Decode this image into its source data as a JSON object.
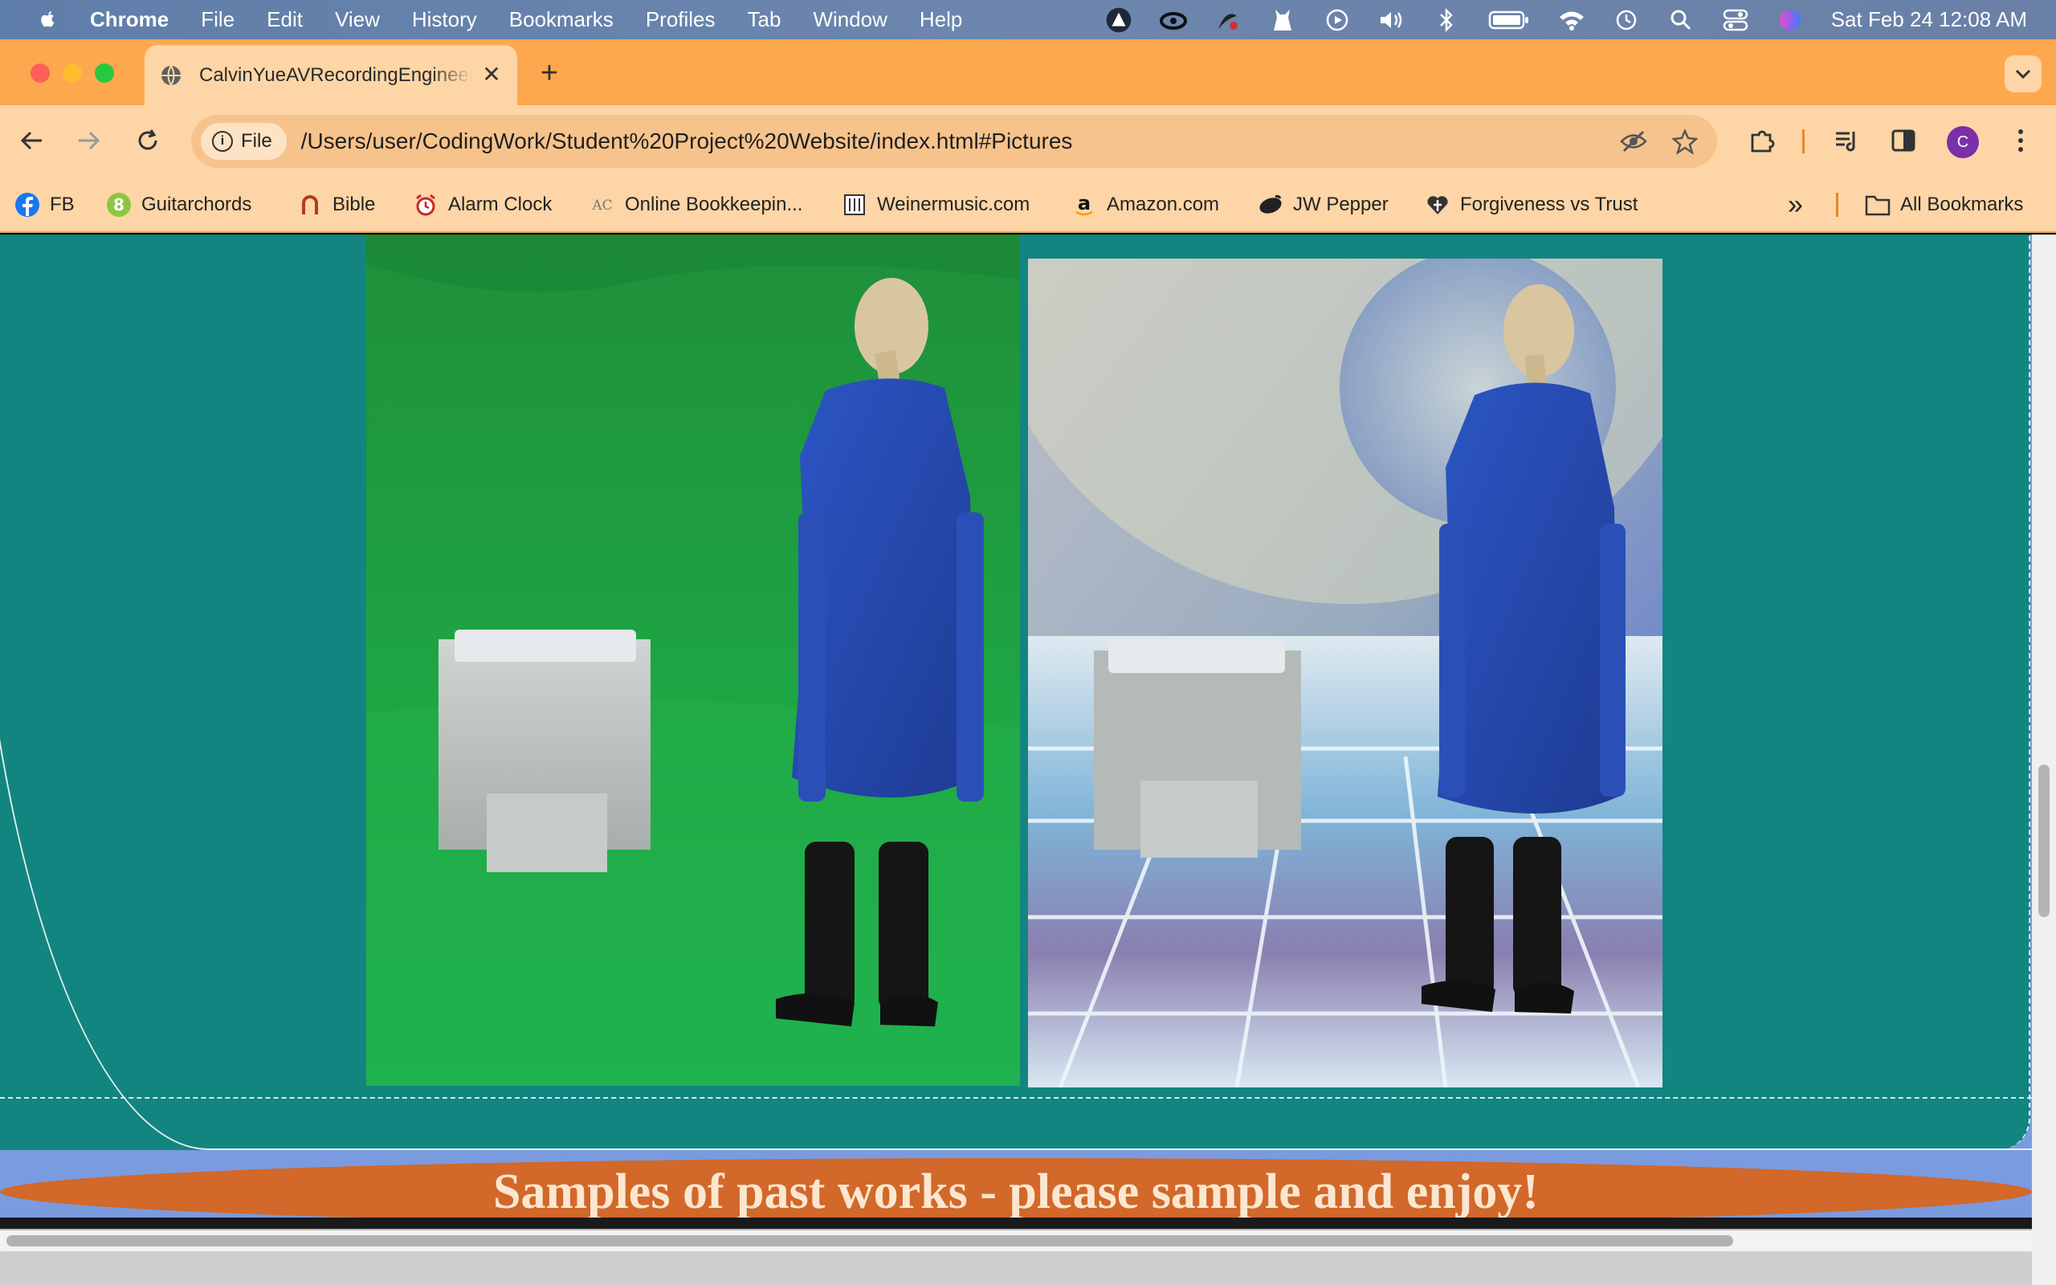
{
  "menubar": {
    "app_name": "Chrome",
    "menus": [
      "File",
      "Edit",
      "View",
      "History",
      "Bookmarks",
      "Profiles",
      "Tab",
      "Window",
      "Help"
    ],
    "clock": "Sat Feb 24  12:08 AM"
  },
  "tab": {
    "title": "CalvinYueAVRecordingEngineer",
    "new_tab": "+"
  },
  "toolbar": {
    "chip_label": "File",
    "url": "/Users/user/CodingWork/Student%20Project%20Website/index.html#Pictures",
    "avatar_letter": "C"
  },
  "bookmarks": {
    "items": [
      "FB",
      "Guitarchords",
      "Bible",
      "Alarm Clock",
      "Online Bookkeepin...",
      "Weinermusic.com",
      "Amazon.com",
      "JW Pepper",
      "Forgiveness vs Trust"
    ],
    "all_label": "All Bookmarks",
    "overflow": "»"
  },
  "page": {
    "banner_text": "Samples of past works - please sample and enjoy!"
  },
  "colors": {
    "teal": "#138580",
    "banner": "#d2682a",
    "tabstrip": "#fda84f",
    "toolbar": "#fdd5a6"
  }
}
